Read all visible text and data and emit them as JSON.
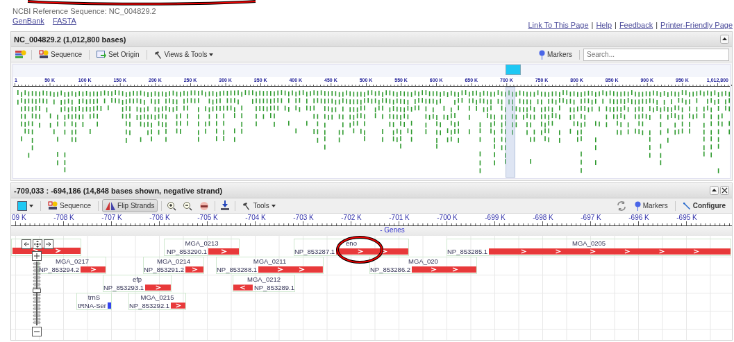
{
  "header": {
    "reference": "NCBI Reference Sequence: NC_004829.2",
    "links": [
      "GenBank",
      "FASTA"
    ]
  },
  "page_links": {
    "items": [
      "Link To This Page",
      "Help",
      "Feedback",
      "Printer-Friendly Page"
    ],
    "separator": "|"
  },
  "overview": {
    "title": "NC_004829.2 (1,012,800 bases)",
    "toolbar": {
      "sequence": "Sequence",
      "set_origin": "Set Origin",
      "views_tools": "Views & Tools",
      "markers": "Markers",
      "search_placeholder": "Search..."
    },
    "ruler_labels": [
      "1",
      "50 K",
      "100 K",
      "150 K",
      "200 K",
      "250 K",
      "300 K",
      "350 K",
      "400 K",
      "450 K",
      "500 K",
      "550 K",
      "600 K",
      "650 K",
      "700 K",
      "750 K",
      "800 K",
      "850 K",
      "900 K",
      "950 K",
      "1,012,800"
    ]
  },
  "detail": {
    "title": "-709,033 : -694,186 (14,848 bases shown, negative strand)",
    "toolbar": {
      "sequence": "Sequence",
      "flip_strands": "Flip Strands",
      "flip_pressed": true,
      "tools": "Tools",
      "markers": "Markers",
      "configure": "Configure"
    },
    "ruler_labels": [
      "09 K",
      "-708 K",
      "-707 K",
      "-706 K",
      "-705 K",
      "-704 K",
      "-703 K",
      "-702 K",
      "-701 K",
      "-700 K",
      "-699 K",
      "-698 K",
      "-697 K",
      "-696 K",
      "-695 K"
    ],
    "track": "- Genes",
    "zoom": {
      "level": 0.55
    },
    "genes": [
      {
        "kind": "gene",
        "reverse": false
      },
      {
        "kind": "gene",
        "name": "MGA_0213",
        "product": "NP_853290.1",
        "reverse": false
      },
      {
        "kind": "gene",
        "name": "eno",
        "product": "NP_853287.1",
        "reverse": false
      },
      {
        "kind": "gene",
        "name": "MGA_0205",
        "product": "NP_853285.1",
        "reverse": false
      },
      {
        "kind": "gene",
        "name": "MGA_0217",
        "product": "NP_853294.2",
        "reverse": false
      },
      {
        "kind": "gene",
        "name": "MGA_0214",
        "product": "NP_853291.2",
        "reverse": false
      },
      {
        "kind": "gene",
        "name": "MGA_0211",
        "product": "NP_853288.1",
        "reverse": false
      },
      {
        "kind": "gene",
        "name": "MGA_020",
        "product": "NP_853286.2",
        "reverse": false
      },
      {
        "kind": "gene",
        "name": "efp",
        "product": "NP_853293.1",
        "reverse": false
      },
      {
        "kind": "gene",
        "name": "MGA_0212",
        "product": "NP_853289.1",
        "reverse": true
      },
      {
        "kind": "trna",
        "name": "trnS",
        "product": "tRNA-Ser",
        "reverse": false
      },
      {
        "kind": "gene",
        "name": "MGA_0215",
        "product": "NP_853292.1",
        "reverse": false
      }
    ]
  }
}
